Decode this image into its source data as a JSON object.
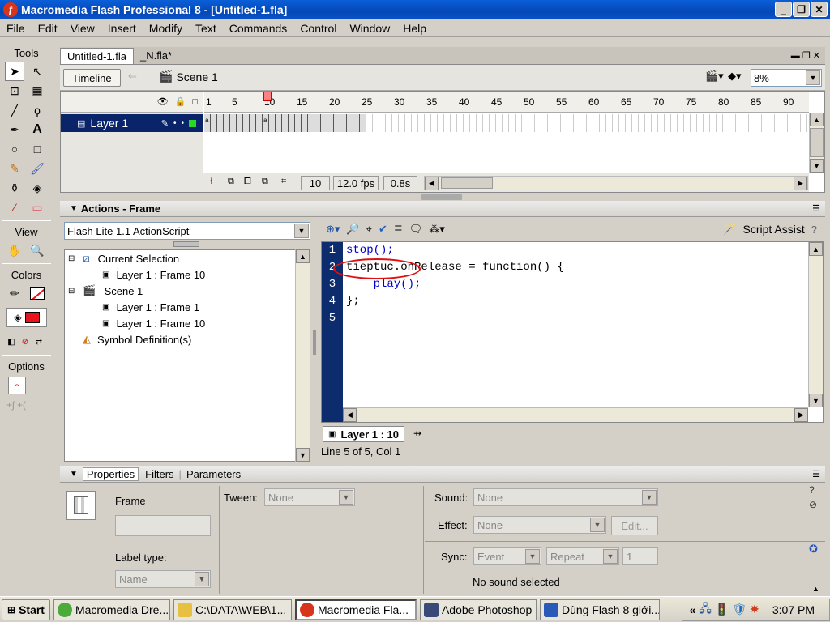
{
  "window": {
    "title": "Macromedia Flash Professional 8 - [Untitled-1.fla]"
  },
  "menu": [
    "File",
    "Edit",
    "View",
    "Insert",
    "Modify",
    "Text",
    "Commands",
    "Control",
    "Window",
    "Help"
  ],
  "tools": {
    "header": "Tools",
    "view_label": "View",
    "colors_label": "Colors",
    "options_label": "Options",
    "fill_color": "#e8141b",
    "stroke_color": "#000000"
  },
  "doc_tabs": [
    "Untitled-1.fla",
    "_N.fla*"
  ],
  "timeline_bar": {
    "timeline_btn": "Timeline",
    "scene": "Scene 1",
    "zoom": "8%"
  },
  "timeline": {
    "ruler": [
      "1",
      "5",
      "10",
      "15",
      "20",
      "25",
      "30",
      "35",
      "40",
      "45",
      "50",
      "55",
      "60",
      "65",
      "70",
      "75",
      "80",
      "85",
      "90"
    ],
    "layer_name": "Layer 1",
    "current_frame": "10",
    "fps": "12.0 fps",
    "time": "0.8s"
  },
  "actions": {
    "title": "Actions - Frame",
    "script_version": "Flash Lite 1.1 ActionScript",
    "script_assist": "Script Assist",
    "tree": {
      "current_selection": "Current Selection",
      "cs_layer": "Layer 1 : Frame 10",
      "scene": "Scene 1",
      "scene_f1": "Layer 1 : Frame 1",
      "scene_f10": "Layer 1 : Frame 10",
      "symbol_defs": "Symbol Definition(s)"
    },
    "code_lines": [
      {
        "n": "1",
        "t": "stop();"
      },
      {
        "n": "2",
        "t": "tieptuc.onRelease = function() {"
      },
      {
        "n": "3",
        "t": "    play();"
      },
      {
        "n": "4",
        "t": "};"
      },
      {
        "n": "5",
        "t": ""
      }
    ],
    "tab_label": "Layer 1 : 10",
    "status": "Line 5 of 5, Col 1"
  },
  "properties": {
    "tabs": [
      "Properties",
      "Filters",
      "Parameters"
    ],
    "frame_label": "Frame",
    "label_type": "Label type:",
    "label_type_value": "Name",
    "tween_label": "Tween:",
    "tween_value": "None",
    "sound_label": "Sound:",
    "sound_value": "None",
    "effect_label": "Effect:",
    "effect_value": "None",
    "edit_btn": "Edit...",
    "sync_label": "Sync:",
    "sync_value": "Event",
    "repeat_value": "Repeat",
    "repeat_count": "1",
    "no_sound": "No sound selected"
  },
  "taskbar": {
    "start": "Start",
    "tasks": [
      "Macromedia Dre...",
      "C:\\DATA\\WEB\\1...",
      "Macromedia Fla...",
      "Adobe Photoshop",
      "Dùng Flash 8 giới..."
    ],
    "clock": "3:07 PM",
    "chevron": "«"
  }
}
